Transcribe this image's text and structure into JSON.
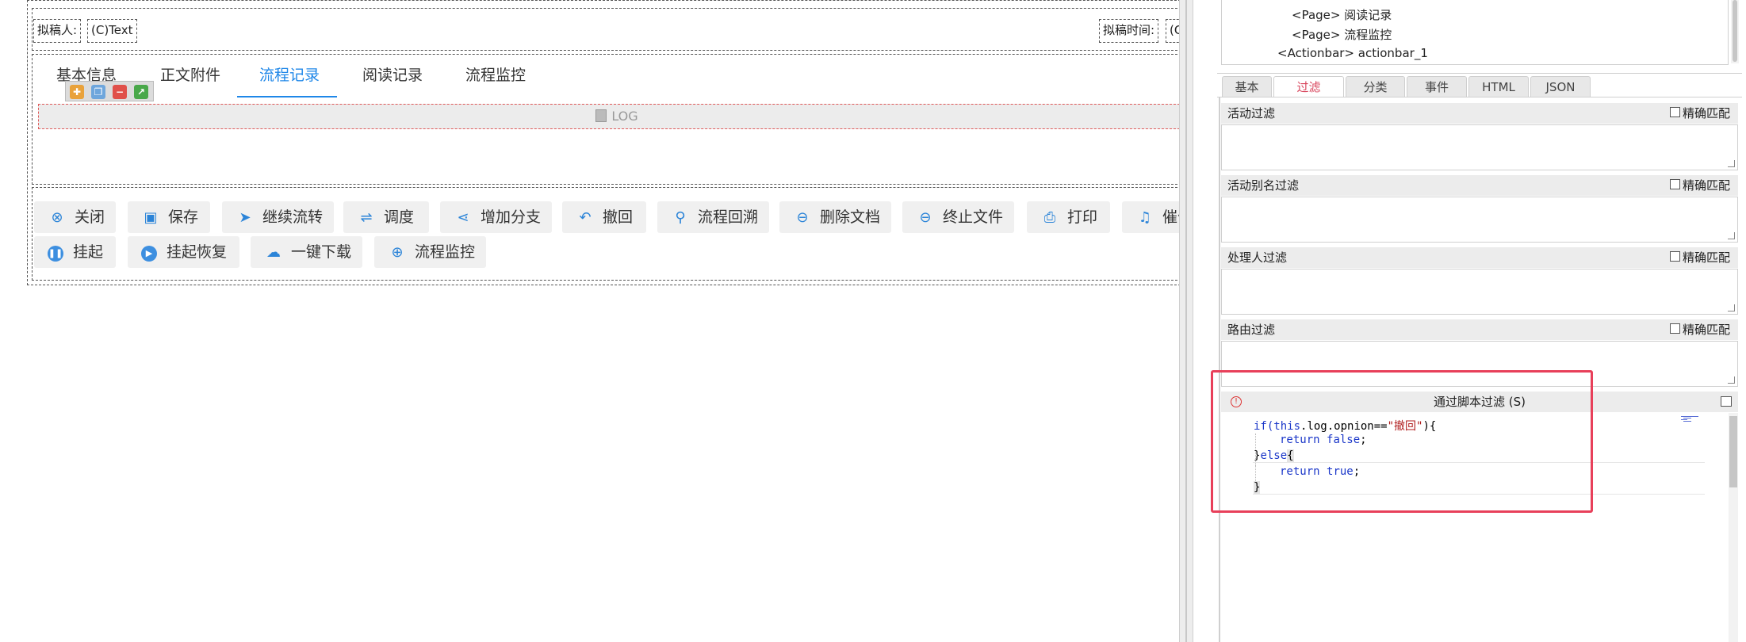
{
  "form": {
    "drafter_label": "拟稿人:",
    "drafter_value": "(C)Text",
    "draft_time_label": "拟稿时间:",
    "draft_time_value": "(C"
  },
  "tabs": [
    {
      "label": "基本信息",
      "active": false
    },
    {
      "label": "正文附件",
      "active": false
    },
    {
      "label": "流程记录",
      "active": true
    },
    {
      "label": "阅读记录",
      "active": false
    },
    {
      "label": "流程监控",
      "active": false
    }
  ],
  "log_label": "LOG",
  "action_buttons_row1": [
    {
      "label": "关闭",
      "icon": "close-circle-icon"
    },
    {
      "label": "保存",
      "icon": "save-icon"
    },
    {
      "label": "继续流转",
      "icon": "send-icon"
    },
    {
      "label": "调度",
      "icon": "dispatch-icon"
    },
    {
      "label": "增加分支",
      "icon": "branch-icon"
    },
    {
      "label": "撤回",
      "icon": "undo-icon"
    },
    {
      "label": "流程回溯",
      "icon": "trace-back-icon"
    },
    {
      "label": "删除文档",
      "icon": "minus-circle-icon"
    },
    {
      "label": "终止文件",
      "icon": "minus-circle-icon"
    },
    {
      "label": "打印",
      "icon": "print-icon"
    },
    {
      "label": "催化",
      "icon": "bell-icon"
    }
  ],
  "action_buttons_row2": [
    {
      "label": "挂起",
      "icon": "pause-icon"
    },
    {
      "label": "挂起恢复",
      "icon": "play-icon"
    },
    {
      "label": "一键下载",
      "icon": "cloud-download-icon"
    },
    {
      "label": "流程监控",
      "icon": "target-icon"
    }
  ],
  "tree": [
    "<Page> 阅读记录",
    "<Page> 流程监控",
    "<Actionbar> actionbar_1"
  ],
  "panel_tabs": [
    {
      "label": "基本",
      "active": false
    },
    {
      "label": "过滤",
      "active": true
    },
    {
      "label": "分类",
      "active": false
    },
    {
      "label": "事件",
      "active": false
    },
    {
      "label": "HTML",
      "active": false
    },
    {
      "label": "JSON",
      "active": false
    }
  ],
  "filters": [
    {
      "title": "活动过滤",
      "exact_label": "精确匹配"
    },
    {
      "title": "活动别名过滤",
      "exact_label": "精确匹配"
    },
    {
      "title": "处理人过滤",
      "exact_label": "精确匹配"
    },
    {
      "title": "路由过滤",
      "exact_label": "精确匹配"
    }
  ],
  "script_filter": {
    "title": "通过脚本过滤 (S)",
    "code": {
      "l1_a": "if(",
      "l1_b": "this",
      "l1_c": ".log.opnion==",
      "l1_d": "\"撤回\"",
      "l1_e": "){",
      "l2_a": "return",
      "l2_b": "false",
      "l2_c": ";",
      "l3_a": "}",
      "l3_b": "else",
      "l3_c": "{",
      "l4_a": "return",
      "l4_b": "true",
      "l4_c": ";",
      "l5": "}"
    }
  },
  "colors": {
    "accent": "#1f87e8",
    "active_panel_tab": "#d8455c",
    "highlight_box": "#e8405a"
  }
}
